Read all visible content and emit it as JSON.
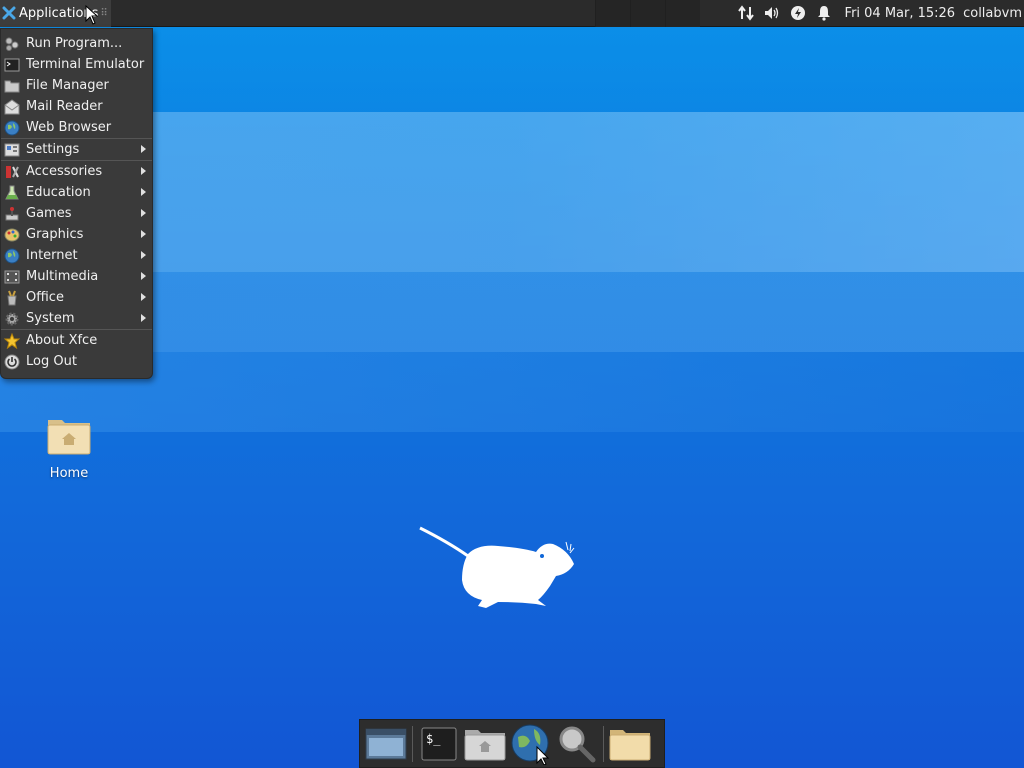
{
  "top_panel": {
    "apps_label": "Applications",
    "handle": "⠿",
    "clock": "Fri 04 Mar, 15:26",
    "user": "collabvm",
    "tray_icons": [
      "network-transfer-icon",
      "volume-icon",
      "power-icon",
      "notification-bell-icon"
    ]
  },
  "menu": {
    "items": [
      {
        "label": "Run Program...",
        "icon": "run-program-icon",
        "submenu": false
      },
      {
        "label": "Terminal Emulator",
        "icon": "terminal-icon",
        "submenu": false
      },
      {
        "label": "File Manager",
        "icon": "folder-icon",
        "submenu": false
      },
      {
        "label": "Mail Reader",
        "icon": "mail-icon",
        "submenu": false
      },
      {
        "label": "Web Browser",
        "icon": "globe-icon",
        "submenu": false
      },
      {
        "label": "Settings",
        "icon": "settings-icon",
        "submenu": true
      },
      {
        "label": "Accessories",
        "icon": "accessories-icon",
        "submenu": true
      },
      {
        "label": "Education",
        "icon": "education-icon",
        "submenu": true
      },
      {
        "label": "Games",
        "icon": "games-icon",
        "submenu": true
      },
      {
        "label": "Graphics",
        "icon": "graphics-icon",
        "submenu": true
      },
      {
        "label": "Internet",
        "icon": "internet-icon",
        "submenu": true
      },
      {
        "label": "Multimedia",
        "icon": "multimedia-icon",
        "submenu": true
      },
      {
        "label": "Office",
        "icon": "office-icon",
        "submenu": true
      },
      {
        "label": "System",
        "icon": "system-gear-icon",
        "submenu": true
      },
      {
        "label": "About Xfce",
        "icon": "star-icon",
        "submenu": false
      },
      {
        "label": "Log Out",
        "icon": "logout-icon",
        "submenu": false
      }
    ]
  },
  "desktop": {
    "home_label": "Home"
  },
  "dock": {
    "items": [
      "show-desktop-icon",
      "terminal-icon",
      "home-folder-icon",
      "web-browser-icon",
      "search-icon",
      "folder-icon"
    ]
  },
  "colors": {
    "panel": "#2b2b2b",
    "menu": "#3a3a3a",
    "desktop_blue": "#1067d8"
  }
}
